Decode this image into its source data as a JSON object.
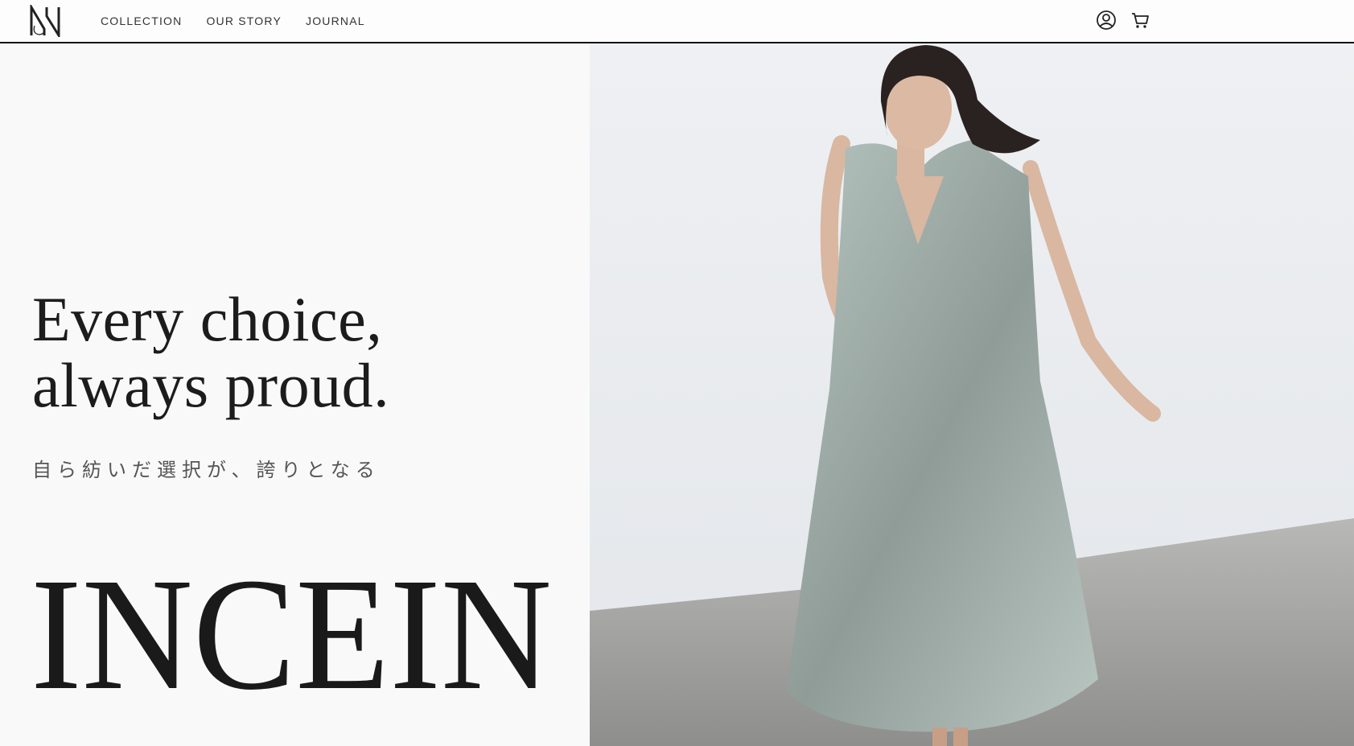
{
  "header": {
    "logo_icon": "monogram-logo",
    "nav": [
      {
        "label": "COLLECTION"
      },
      {
        "label": "OUR STORY"
      },
      {
        "label": "JOURNAL"
      }
    ],
    "icons": [
      "account-icon",
      "cart-icon"
    ]
  },
  "hero": {
    "title_line1": "Every choice,",
    "title_line2": "always proud.",
    "subtitle": "自ら紡いだ選択が、誇りとなる",
    "brand_wordmark": "INCEIN",
    "image": "woman-in-sage-dress-photo"
  },
  "colors": {
    "text": "#1c1c1c",
    "background": "#f9f9fa",
    "dress": "#a9b7b2"
  }
}
